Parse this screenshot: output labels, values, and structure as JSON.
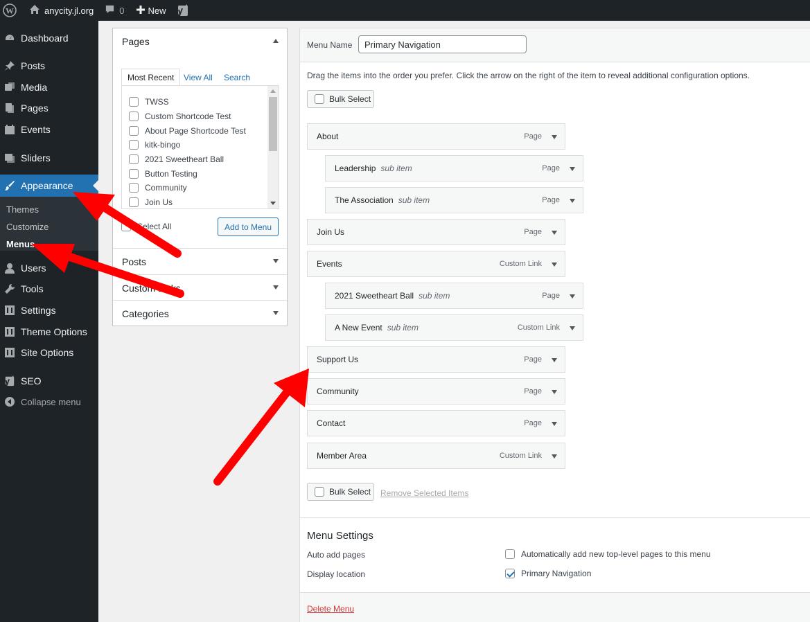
{
  "admin_bar": {
    "site_name": "anycity.jl.org",
    "comments_count": "0",
    "new_label": "New"
  },
  "sidebar": {
    "items": [
      {
        "label": "Dashboard",
        "icon": "dashboard-icon"
      },
      {
        "label": "Posts",
        "icon": "pin-icon"
      },
      {
        "label": "Media",
        "icon": "media-icon"
      },
      {
        "label": "Pages",
        "icon": "pages-icon"
      },
      {
        "label": "Events",
        "icon": "calendar-icon"
      },
      {
        "label": "Sliders",
        "icon": "slider-icon"
      },
      {
        "label": "Appearance",
        "icon": "brush-icon"
      },
      {
        "label": "Users",
        "icon": "users-icon"
      },
      {
        "label": "Tools",
        "icon": "wrench-icon"
      },
      {
        "label": "Settings",
        "icon": "settings-icon"
      },
      {
        "label": "Theme Options",
        "icon": "settings-icon"
      },
      {
        "label": "Site Options",
        "icon": "settings-icon"
      },
      {
        "label": "SEO",
        "icon": "yoast-icon"
      },
      {
        "label": "Collapse menu",
        "icon": "collapse-icon"
      }
    ],
    "submenu": [
      "Themes",
      "Customize",
      "Menus"
    ]
  },
  "left_panel": {
    "pages_title": "Pages",
    "tabs": [
      "Most Recent",
      "View All",
      "Search"
    ],
    "pages": [
      "TWSS",
      "Custom Shortcode Test",
      "About Page Shortcode Test",
      "kitk-bingo",
      "2021 Sweetheart Ball",
      "Button Testing",
      "Community",
      "Join Us"
    ],
    "select_all": "Select All",
    "add_to_menu": "Add to Menu",
    "sections": [
      "Posts",
      "Custom Links",
      "Categories"
    ]
  },
  "main": {
    "menu_name_label": "Menu Name",
    "menu_name_value": "Primary Navigation",
    "instructions": "Drag the items into the order you prefer. Click the arrow on the right of the item to reveal additional configuration options.",
    "bulk_select": "Bulk Select",
    "remove_selected": "Remove Selected Items",
    "sub_item_label": "sub item",
    "menu_items": [
      {
        "title": "About",
        "type": "Page",
        "sub": false
      },
      {
        "title": "Leadership",
        "type": "Page",
        "sub": true
      },
      {
        "title": "The Association",
        "type": "Page",
        "sub": true
      },
      {
        "title": "Join Us",
        "type": "Page",
        "sub": false
      },
      {
        "title": "Events",
        "type": "Custom Link",
        "sub": false
      },
      {
        "title": "2021 Sweetheart Ball",
        "type": "Page",
        "sub": true
      },
      {
        "title": "A New Event",
        "type": "Custom Link",
        "sub": true
      },
      {
        "title": "Support Us",
        "type": "Page",
        "sub": false
      },
      {
        "title": "Community",
        "type": "Page",
        "sub": false
      },
      {
        "title": "Contact",
        "type": "Page",
        "sub": false
      },
      {
        "title": "Member Area",
        "type": "Custom Link",
        "sub": false
      }
    ],
    "settings": {
      "title": "Menu Settings",
      "auto_add_label": "Auto add pages",
      "auto_add_option": "Automatically add new top-level pages to this menu",
      "display_label": "Display location",
      "display_option": "Primary Navigation"
    },
    "delete_menu": "Delete Menu"
  },
  "colors": {
    "admin_dark": "#1d2327",
    "accent": "#2271b1",
    "arrow_red": "#ff0000",
    "delete_red": "#d63638"
  }
}
